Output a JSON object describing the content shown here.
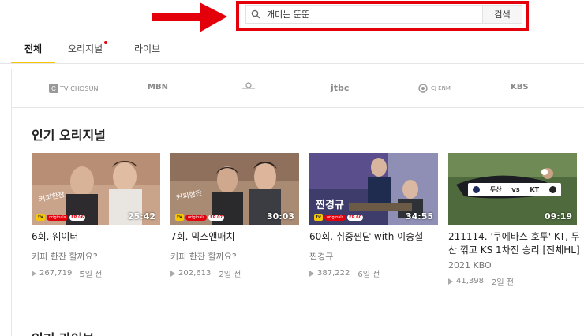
{
  "search": {
    "query": "개미는 뚠뚠",
    "button_label": "검색"
  },
  "tabs": [
    {
      "label": "전체",
      "active": true
    },
    {
      "label": "오리지널",
      "has_dot": true
    },
    {
      "label": "라이브"
    }
  ],
  "channels": [
    "TV CHOSUN",
    "MBN",
    "SBS",
    "jtbc",
    "CJ ENM",
    "KBS"
  ],
  "sections": {
    "popular_originals": "인기 오리지널",
    "popular_live": "인기 라이브"
  },
  "cards": [
    {
      "title": "6회. 웨이터",
      "channel": "커피 한잔 할까요?",
      "views": "267,719",
      "age": "5일 전",
      "duration": "25:42",
      "badge": "originals",
      "ep": "EP 06"
    },
    {
      "title": "7회. 믹스앤매치",
      "channel": "커피 한잔 할까요?",
      "views": "202,613",
      "age": "2일 전",
      "duration": "30:03",
      "badge": "originals",
      "ep": "EP 07"
    },
    {
      "title": "60회. 취중찐담 with 이승철",
      "channel": "찐경규",
      "views": "387,222",
      "age": "6일 전",
      "duration": "34:55",
      "badge": "originals",
      "ep": "EP 60"
    },
    {
      "title": "211114. '쿠에바스 호투' KT, 두산 꺾고 KS 1차전 승리 [전체HL]",
      "channel": "2021 KBO",
      "views": "41,398",
      "age": "2일 전",
      "duration": "09:19",
      "scoreboard": {
        "team1": "두산",
        "vs": "VS",
        "team2": "KT"
      }
    }
  ],
  "colors": {
    "accent": "#f7c600",
    "highlight_red": "#e3000b"
  }
}
